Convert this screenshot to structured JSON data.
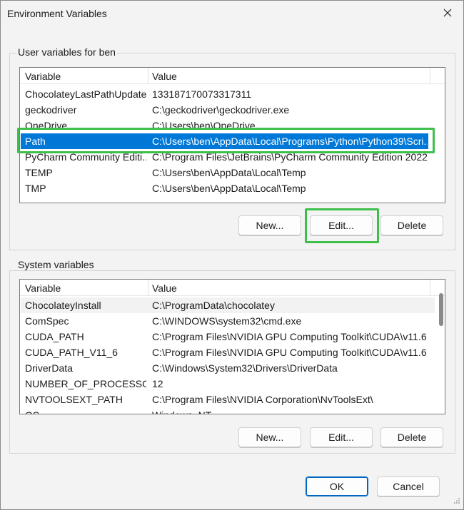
{
  "window": {
    "title": "Environment Variables"
  },
  "user_group": {
    "label": "User variables for ben",
    "columns": [
      "Variable",
      "Value"
    ],
    "rows": [
      {
        "variable": "ChocolateyLastPathUpdate",
        "value": "133187170073317311"
      },
      {
        "variable": "geckodriver",
        "value": "C:\\geckodriver\\geckodriver.exe"
      },
      {
        "variable": "OneDrive",
        "value": "C:\\Users\\ben\\OneDrive"
      },
      {
        "variable": "Path",
        "value": "C:\\Users\\ben\\AppData\\Local\\Programs\\Python\\Python39\\Scri..."
      },
      {
        "variable": "PyCharm Community Editi...",
        "value": "C:\\Program Files\\JetBrains\\PyCharm Community Edition 2022..."
      },
      {
        "variable": "TEMP",
        "value": "C:\\Users\\ben\\AppData\\Local\\Temp"
      },
      {
        "variable": "TMP",
        "value": "C:\\Users\\ben\\AppData\\Local\\Temp"
      }
    ],
    "selected_row": "Path",
    "buttons": {
      "new": "New...",
      "edit": "Edit...",
      "delete": "Delete"
    }
  },
  "system_group": {
    "label": "System variables",
    "columns": [
      "Variable",
      "Value"
    ],
    "rows": [
      {
        "variable": "ChocolateyInstall",
        "value": "C:\\ProgramData\\chocolatey"
      },
      {
        "variable": "ComSpec",
        "value": "C:\\WINDOWS\\system32\\cmd.exe"
      },
      {
        "variable": "CUDA_PATH",
        "value": "C:\\Program Files\\NVIDIA GPU Computing Toolkit\\CUDA\\v11.6"
      },
      {
        "variable": "CUDA_PATH_V11_6",
        "value": "C:\\Program Files\\NVIDIA GPU Computing Toolkit\\CUDA\\v11.6"
      },
      {
        "variable": "DriverData",
        "value": "C:\\Windows\\System32\\Drivers\\DriverData"
      },
      {
        "variable": "NUMBER_OF_PROCESSORS",
        "value": "12"
      },
      {
        "variable": "NVTOOLSEXT_PATH",
        "value": "C:\\Program Files\\NVIDIA Corporation\\NvToolsExt\\"
      },
      {
        "variable": "OS",
        "value": "Windows_NT"
      }
    ],
    "buttons": {
      "new": "New...",
      "edit": "Edit...",
      "delete": "Delete"
    }
  },
  "footer": {
    "ok": "OK",
    "cancel": "Cancel"
  },
  "colors": {
    "selection": "#0078d7",
    "highlight_box": "#3dc04a",
    "primary_border": "#0067c0"
  },
  "icons": {
    "close": "close-icon",
    "resize": "resize-grip-icon"
  }
}
